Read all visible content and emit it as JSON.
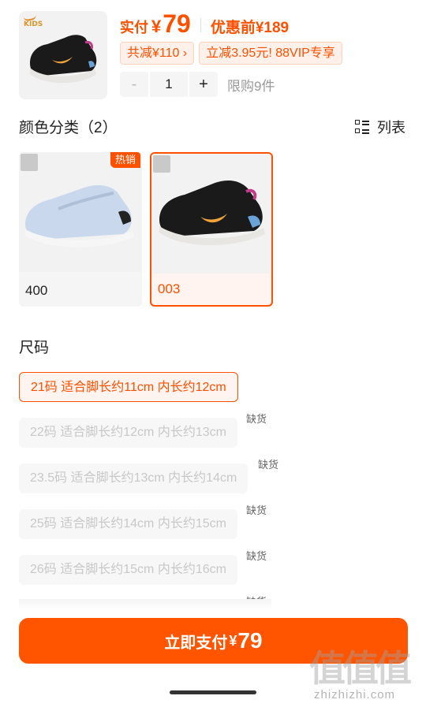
{
  "product": {
    "brand_logo_text": "KIDS",
    "price_label": "实付",
    "currency": "¥",
    "price": "79",
    "original_price_text": "优惠前¥189",
    "promos": [
      "共减¥110 ›",
      "立减3.95元! 88VIP专享"
    ],
    "quantity": {
      "minus": "-",
      "value": "1",
      "plus": "+"
    },
    "limit_text": "限购9件"
  },
  "color_section": {
    "title": "颜色分类（2）",
    "view_toggle_label": "列表",
    "options": [
      {
        "label": "400",
        "badge": "热销",
        "selected": false,
        "shoe_color": "#c9d8ec"
      },
      {
        "label": "003",
        "badge": "",
        "selected": true,
        "shoe_color": "#1a1a1a"
      }
    ]
  },
  "size_section": {
    "title": "尺码",
    "out_of_stock_label": "缺货",
    "options": [
      {
        "label": "21码 适合脚长约11cm 内长约12cm",
        "selected": true,
        "out_of_stock": false
      },
      {
        "label": "22码 适合脚长约12cm 内长约13cm",
        "selected": false,
        "out_of_stock": true
      },
      {
        "label": "23.5码 适合脚长约13cm 内长约14cm",
        "selected": false,
        "out_of_stock": true
      },
      {
        "label": "25码 适合脚长约14cm 内长约15cm",
        "selected": false,
        "out_of_stock": true
      },
      {
        "label": "26码 适合脚长约15cm 内长约16cm",
        "selected": false,
        "out_of_stock": true
      }
    ],
    "partial_row_oos_label": "缺货"
  },
  "footer": {
    "pay_label": "立即支付",
    "pay_currency": "¥",
    "pay_amount": "79"
  },
  "watermark": {
    "mark": "值值值",
    "text": "zhizhizhi.com"
  },
  "colors": {
    "accent": "#ff5000",
    "selected_bg": "#fff4ef",
    "disabled_text": "#c8c8c8"
  }
}
